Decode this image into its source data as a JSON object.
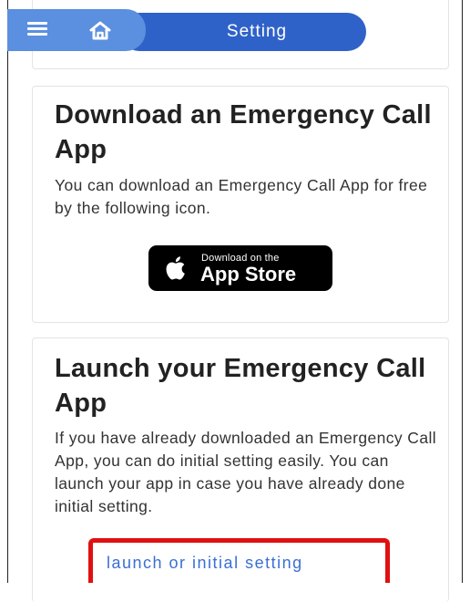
{
  "header": {
    "title": "Setting",
    "menu_icon": "hamburger-menu-icon",
    "home_icon": "home-icon",
    "colors": {
      "pill": "#2f62c9",
      "tab": "#5b8fdf"
    }
  },
  "download_card": {
    "title": "Download an Emergency Call App",
    "description": "You can download an Emergency Call App for free by the following icon.",
    "badge": {
      "small_text": "Download on the",
      "big_text": "App Store",
      "icon": "apple-icon"
    }
  },
  "launch_card": {
    "title": "Launch your Emergency Call App",
    "description": "If you have already downloaded an Emergency Call App, you can do initial setting easily. You can launch your app in case you have already done initial setting.",
    "link_label": "launch or initial setting",
    "link_color": "#3a6fd4",
    "highlight_color": "#e01010"
  }
}
